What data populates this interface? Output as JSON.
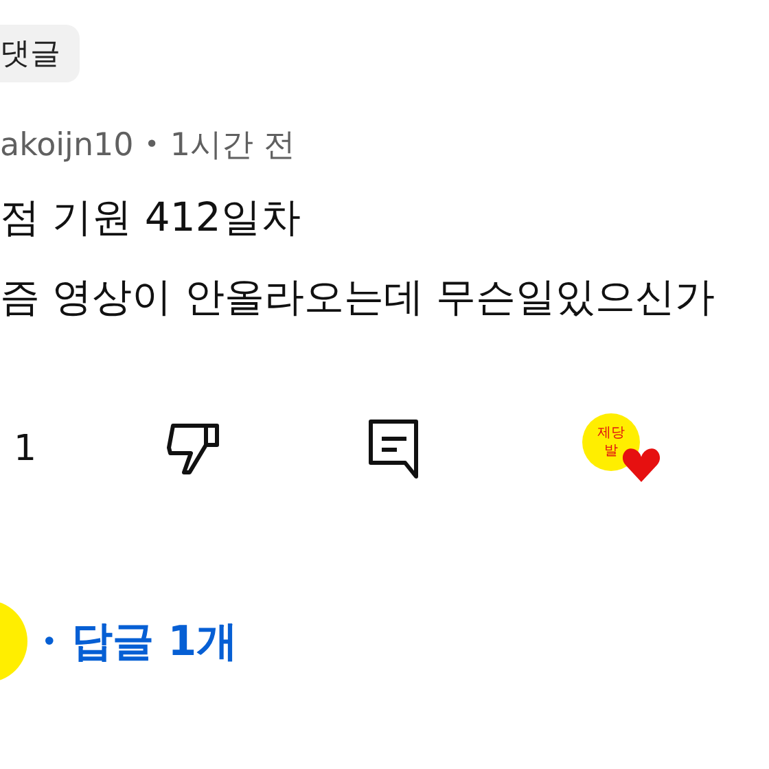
{
  "chip": {
    "label": "댓글"
  },
  "comment": {
    "author": "akoijn10",
    "separator": "•",
    "time": "1시간 전",
    "lines": [
      "점 기원 412일차",
      "즘 영상이 안올라오는데 무슨일있으신가"
    ]
  },
  "actions": {
    "likes": "1",
    "creator_heart": {
      "line1": "제당",
      "line2": "발",
      "hearted": true
    }
  },
  "replies": {
    "separator": "•",
    "label": "답글 1개"
  }
}
